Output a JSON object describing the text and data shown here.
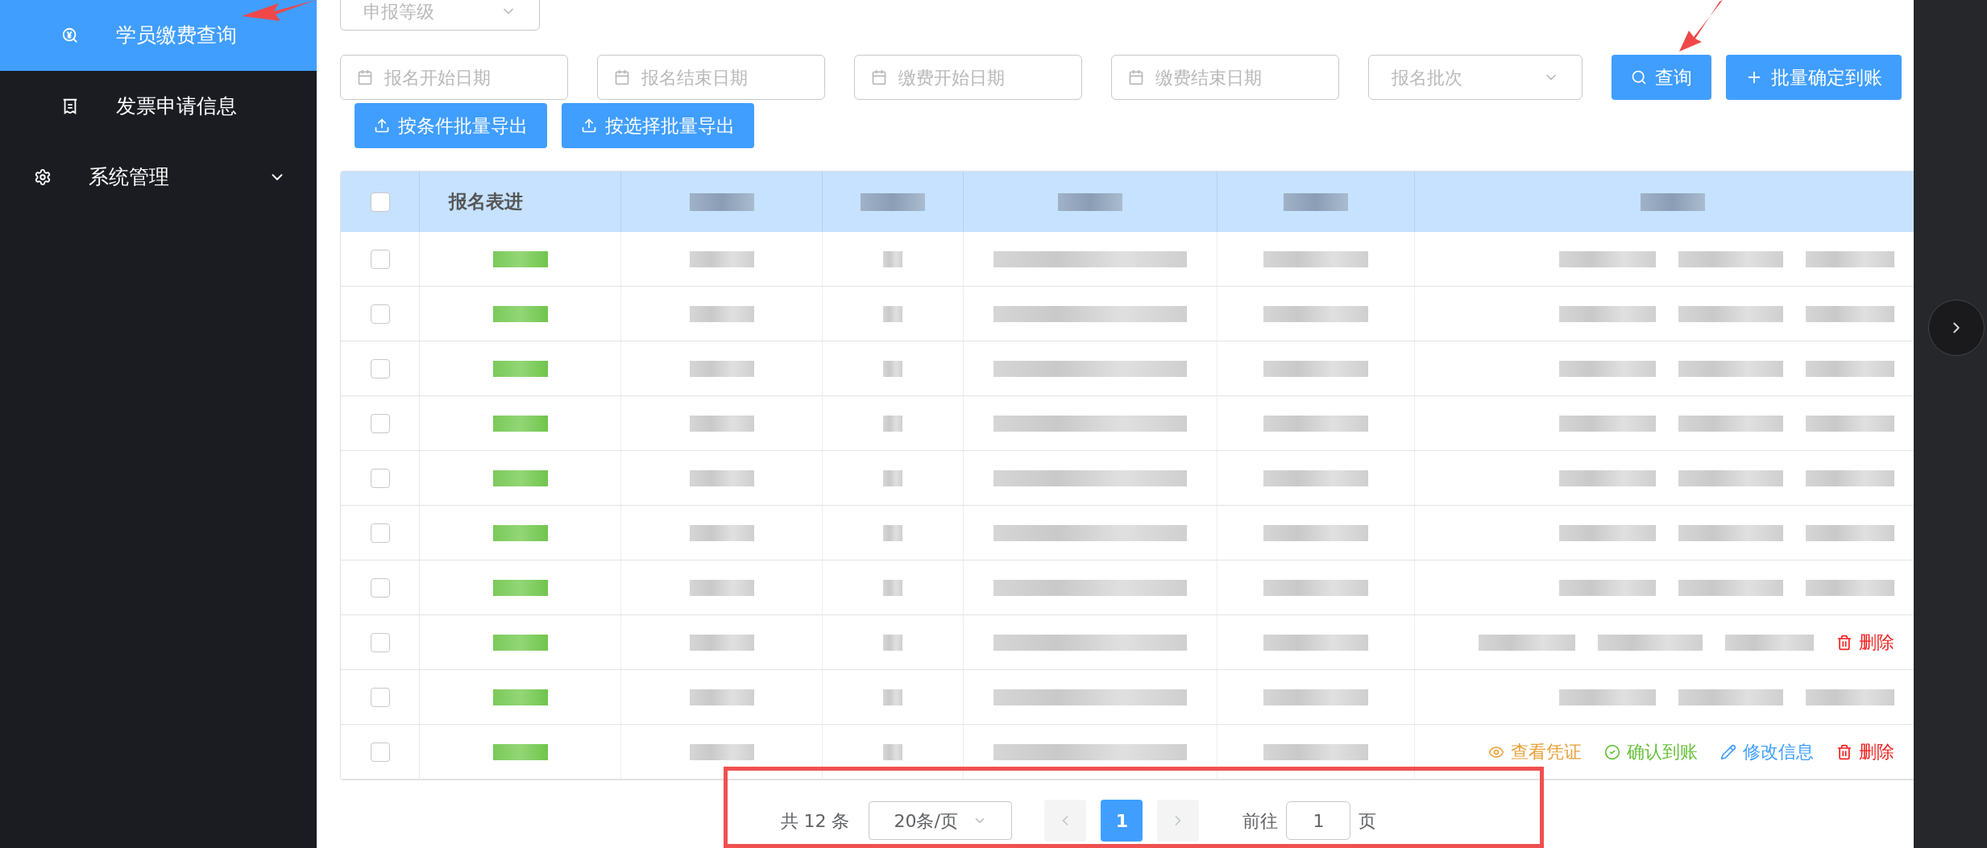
{
  "sidebar": {
    "items": [
      {
        "label": "学员缴费查询",
        "selected": true
      },
      {
        "label": "发票申请信息",
        "selected": false
      },
      {
        "label": "系统管理",
        "selected": false,
        "expandable": true
      }
    ]
  },
  "filters": {
    "top_select": {
      "placeholder": "申报等级"
    },
    "dates": [
      {
        "placeholder": "报名开始日期"
      },
      {
        "placeholder": "报名结束日期"
      },
      {
        "placeholder": "缴费开始日期"
      },
      {
        "placeholder": "缴费结束日期"
      }
    ],
    "batch_select": {
      "placeholder": "报名批次"
    },
    "buttons": [
      {
        "label": "查询"
      },
      {
        "label": "批量确定到账"
      }
    ],
    "export_buttons": [
      {
        "label": "按条件批量导出"
      },
      {
        "label": "按选择批量导出"
      }
    ]
  },
  "table": {
    "header_checked": false,
    "columns": [
      {
        "kind": "text",
        "label": "报名表进"
      },
      {
        "kind": "blurred"
      },
      {
        "kind": "blurred"
      },
      {
        "kind": "blurred"
      },
      {
        "kind": "blurred"
      },
      {
        "kind": "blurred"
      }
    ],
    "rows": [
      {
        "kind": "blurred",
        "checked": false
      },
      {
        "kind": "blurred",
        "checked": false
      },
      {
        "kind": "blurred",
        "checked": false
      },
      {
        "kind": "blurred",
        "checked": false
      },
      {
        "kind": "blurred",
        "checked": false
      },
      {
        "kind": "blurred",
        "checked": false
      },
      {
        "kind": "blurred",
        "checked": false
      },
      {
        "kind": "blurred",
        "checked": false,
        "actions": [
          {
            "kind": "delete",
            "label": "删除"
          }
        ]
      },
      {
        "kind": "blurred",
        "checked": false
      },
      {
        "kind": "partial",
        "checked": false,
        "actions": [
          {
            "kind": "view",
            "label": "查看凭证"
          },
          {
            "kind": "confirm",
            "label": "确认到账"
          },
          {
            "kind": "edit",
            "label": "修改信息"
          },
          {
            "kind": "delete",
            "label": "删除"
          }
        ]
      }
    ]
  },
  "pagination": {
    "total": "共 12 条",
    "page_size": "20条/页",
    "prev_disabled": true,
    "next_disabled": true,
    "pages": [
      {
        "label": "1",
        "selected": true
      }
    ],
    "goto_label": "前往",
    "goto_value": "1",
    "goto_suffix": "页"
  }
}
